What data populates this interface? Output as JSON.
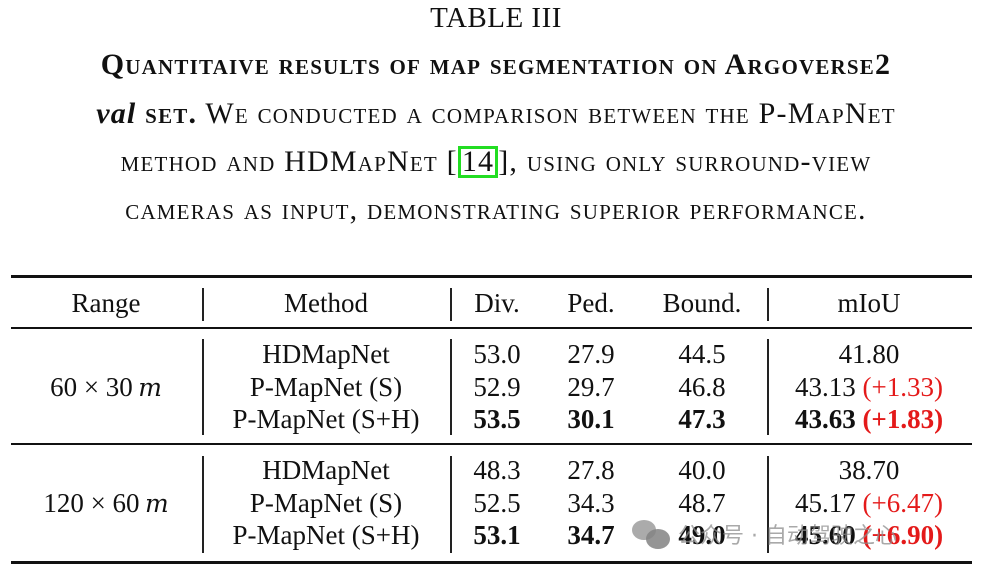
{
  "caption": {
    "table_label": "TABLE III",
    "line1": "Quantitaive results of map segmentation on Argoverse2",
    "line2_italic": "val",
    "line2_bold": " set.",
    "line2_rest": " We conducted a comparison between the P-MapNet",
    "line3_pre": "method and HDMapNet [",
    "line3_ref": "14",
    "line3_post": "], using only surround-view",
    "line4": "cameras as input, demonstrating superior performance."
  },
  "table": {
    "headers": [
      "Range",
      "Method",
      "Div.",
      "Ped.",
      "Bound.",
      "mIoU"
    ],
    "groups": [
      {
        "range": "60 × 30",
        "range_unit": "m",
        "rows": [
          {
            "method": "HDMapNet",
            "div": "53.0",
            "ped": "27.9",
            "bound": "44.5",
            "miou": "41.80",
            "delta": "",
            "bold": false
          },
          {
            "method": "P-MapNet (S)",
            "div": "52.9",
            "ped": "29.7",
            "bound": "46.8",
            "miou": "43.13",
            "delta": "(+1.33)",
            "bold": false
          },
          {
            "method": "P-MapNet (S+H)",
            "div": "53.5",
            "ped": "30.1",
            "bound": "47.3",
            "miou": "43.63",
            "delta": "(+1.83)",
            "bold": true
          }
        ]
      },
      {
        "range": "120 × 60",
        "range_unit": "m",
        "rows": [
          {
            "method": "HDMapNet",
            "div": "48.3",
            "ped": "27.8",
            "bound": "40.0",
            "miou": "38.70",
            "delta": "",
            "bold": false
          },
          {
            "method": "P-MapNet (S)",
            "div": "52.5",
            "ped": "34.3",
            "bound": "48.7",
            "miou": "45.17",
            "delta": "(+6.47)",
            "bold": false
          },
          {
            "method": "P-MapNet (S+H)",
            "div": "53.1",
            "ped": "34.7",
            "bound": "49.0",
            "miou": "45.60",
            "delta": "(+6.90)",
            "bold": true
          }
        ]
      }
    ]
  },
  "colors": {
    "delta": "#e41a1a",
    "ref_box": "#22dd22"
  },
  "watermark": {
    "icon": "wechat-icon",
    "text": "公众号 · 自动驾驶之心"
  }
}
